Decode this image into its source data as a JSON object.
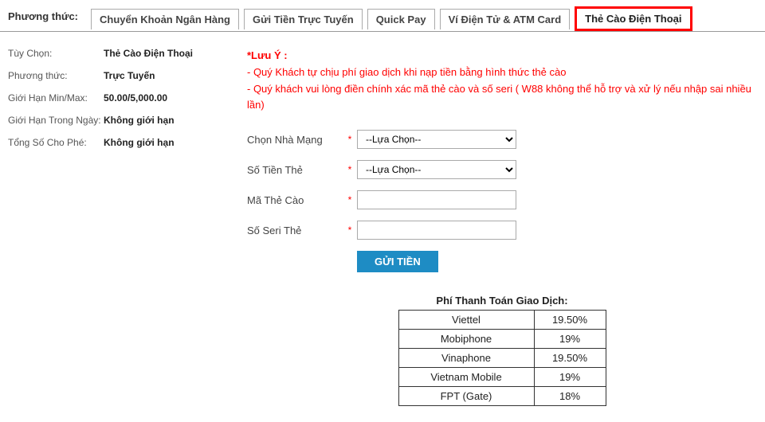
{
  "tabs": {
    "label": "Phương thức:",
    "items": [
      "Chuyển Khoản Ngân Hàng",
      "Gửi Tiền Trực Tuyến",
      "Quick Pay",
      "Ví Điện Tử & ATM Card",
      "Thẻ Cào Điện Thoại"
    ]
  },
  "left": {
    "option_label": "Tùy Chọn:",
    "option_value": "Thẻ Cào Điện Thoại",
    "method_label": "Phương thức:",
    "method_value": "Trực Tuyến",
    "limit_label": "Giới Hạn Min/Max:",
    "limit_value": "50.00/5,000.00",
    "daily_label": "Giới Hạn Trong Ngày:",
    "daily_value": "Không giới hạn",
    "total_label": "Tổng Số Cho Phé:",
    "total_value": "Không giới hạn"
  },
  "notice": {
    "title": "*Lưu Ý :",
    "line1": "- Quý Khách tự chịu phí giao dịch khi nạp tiền bằng hình thức thẻ cào",
    "line2": "- Quý khách vui lòng điền chính xác mã thẻ cào và số seri ( W88 không thể hỗ trợ và xử lý nếu nhập sai nhiều lần)"
  },
  "form": {
    "provider_label": "Chọn Nhà Mạng",
    "amount_label": "Số Tiền Thẻ",
    "code_label": "Mã Thẻ Cào",
    "serial_label": "Số Seri Thẻ",
    "select_placeholder": "--Lựa Chọn--",
    "submit": "GỬI TIỀN"
  },
  "fee": {
    "title": "Phí Thanh Toán Giao Dịch:",
    "rows": [
      {
        "name": "Viettel",
        "pct": "19.50%"
      },
      {
        "name": "Mobiphone",
        "pct": "19%"
      },
      {
        "name": "Vinaphone",
        "pct": "19.50%"
      },
      {
        "name": "Vietnam Mobile",
        "pct": "19%"
      },
      {
        "name": "FPT (Gate)",
        "pct": "18%"
      }
    ]
  }
}
